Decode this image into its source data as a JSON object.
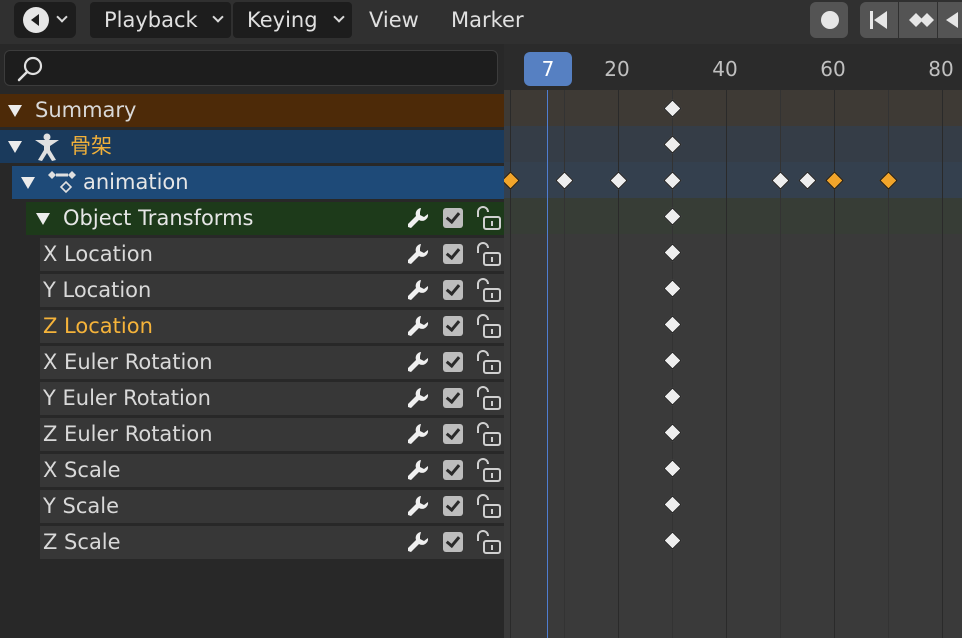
{
  "header": {
    "menus": [
      {
        "label": "Playback",
        "dropdown": true
      },
      {
        "label": "Keying",
        "dropdown": true
      },
      {
        "label": "View",
        "dropdown": false
      },
      {
        "label": "Marker",
        "dropdown": false
      }
    ]
  },
  "search": {
    "placeholder": ""
  },
  "timeline": {
    "current_frame": "7",
    "ticks": [
      "20",
      "40",
      "60",
      "80"
    ]
  },
  "channels": {
    "summary": "Summary",
    "armature": "骨架",
    "action": "animation",
    "group": "Object Transforms",
    "items": [
      {
        "label": "X Location",
        "active": false
      },
      {
        "label": "Y Location",
        "active": false
      },
      {
        "label": "Z Location",
        "active": true
      },
      {
        "label": "X Euler Rotation",
        "active": false
      },
      {
        "label": "Y Euler Rotation",
        "active": false
      },
      {
        "label": "Z Euler Rotation",
        "active": false
      },
      {
        "label": "X Scale",
        "active": false
      },
      {
        "label": "Y Scale",
        "active": false
      },
      {
        "label": "Z Scale",
        "active": false
      }
    ]
  },
  "keyframes": {
    "summary": [
      30
    ],
    "armature": [
      30
    ],
    "action": [
      {
        "frame": 0,
        "selected": true
      },
      {
        "frame": 10,
        "selected": false
      },
      {
        "frame": 20,
        "selected": false
      },
      {
        "frame": 30,
        "selected": false
      },
      {
        "frame": 50,
        "selected": false
      },
      {
        "frame": 55,
        "selected": false
      },
      {
        "frame": 60,
        "selected": true
      },
      {
        "frame": 70,
        "selected": true
      }
    ],
    "channel_frame": 30
  },
  "colors": {
    "summary_bg": "#4d2a08",
    "armature_bg": "#1a3a5c",
    "action_bg": "#1e4a78",
    "group_bg": "#1d3a1a",
    "channel_bg": "#373737",
    "active_text": "#f5b33a",
    "armature_text": "#f0b03a",
    "selected_key": "#f2a52a",
    "key": "#eeeeee",
    "current_frame": "#5680c2"
  },
  "icons": {
    "editor": "dopesheet-editor-icon",
    "record": "record-icon",
    "jump_start": "jump-to-start-icon",
    "keyframe_prev": "keyframe-jump-prev-icon",
    "search": "search-icon",
    "armature": "armature-icon",
    "action": "action-icon",
    "modifier": "wrench-icon",
    "mute": "checkbox-icon",
    "lock": "unlock-icon"
  }
}
